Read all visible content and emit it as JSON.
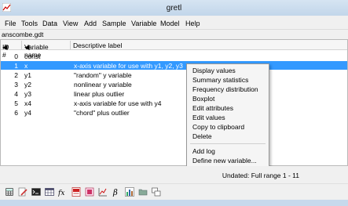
{
  "window": {
    "title": "gretl"
  },
  "menu": [
    "File",
    "Tools",
    "Data",
    "View",
    "Add",
    "Sample",
    "Variable",
    "Model",
    "Help"
  ],
  "dataset": {
    "filename": "anscombe.gdt"
  },
  "columns": {
    "id": "ID #",
    "name": "Variable name",
    "label": "Descriptive label"
  },
  "variables": [
    {
      "id": "0",
      "name": "const",
      "label": ""
    },
    {
      "id": "1",
      "name": "x",
      "label": "x-axis variable for use with y1, y2, y3"
    },
    {
      "id": "2",
      "name": "y1",
      "label": "\"random\" y variable"
    },
    {
      "id": "3",
      "name": "y2",
      "label": "nonlinear y variable"
    },
    {
      "id": "4",
      "name": "y3",
      "label": "linear plus outlier"
    },
    {
      "id": "5",
      "name": "x4",
      "label": "x-axis variable for use with y4"
    },
    {
      "id": "6",
      "name": "y4",
      "label": "\"chord\" plus outlier"
    }
  ],
  "context_menu": {
    "group1": [
      "Display values",
      "Summary statistics",
      "Frequency distribution",
      "Boxplot",
      "Edit attributes",
      "Edit values",
      "Copy to clipboard",
      "Delete"
    ],
    "group2": [
      "Add log",
      "Define new variable..."
    ]
  },
  "status": {
    "text": "Undated: Full range 1 - 11"
  },
  "toolbar_icons": [
    "calculator-icon",
    "edit-icon",
    "terminal-icon",
    "table-icon",
    "formula-icon",
    "pdf-icon",
    "session-icon",
    "graph-icon",
    "beta-icon",
    "chart-icon",
    "folder-icon",
    "windows-icon"
  ]
}
